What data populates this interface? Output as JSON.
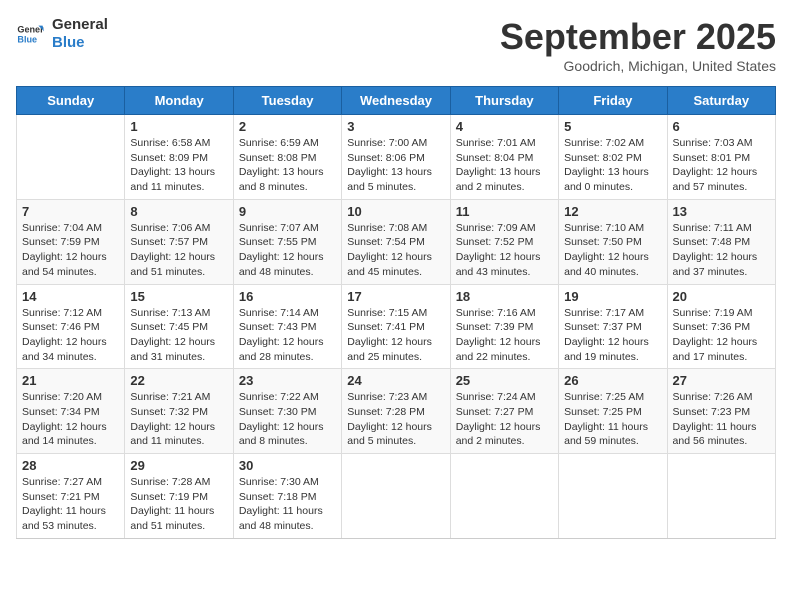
{
  "header": {
    "logo_line1": "General",
    "logo_line2": "Blue",
    "month": "September 2025",
    "location": "Goodrich, Michigan, United States"
  },
  "weekdays": [
    "Sunday",
    "Monday",
    "Tuesday",
    "Wednesday",
    "Thursday",
    "Friday",
    "Saturday"
  ],
  "weeks": [
    [
      {
        "day": "",
        "info": ""
      },
      {
        "day": "1",
        "info": "Sunrise: 6:58 AM\nSunset: 8:09 PM\nDaylight: 13 hours\nand 11 minutes."
      },
      {
        "day": "2",
        "info": "Sunrise: 6:59 AM\nSunset: 8:08 PM\nDaylight: 13 hours\nand 8 minutes."
      },
      {
        "day": "3",
        "info": "Sunrise: 7:00 AM\nSunset: 8:06 PM\nDaylight: 13 hours\nand 5 minutes."
      },
      {
        "day": "4",
        "info": "Sunrise: 7:01 AM\nSunset: 8:04 PM\nDaylight: 13 hours\nand 2 minutes."
      },
      {
        "day": "5",
        "info": "Sunrise: 7:02 AM\nSunset: 8:02 PM\nDaylight: 13 hours\nand 0 minutes."
      },
      {
        "day": "6",
        "info": "Sunrise: 7:03 AM\nSunset: 8:01 PM\nDaylight: 12 hours\nand 57 minutes."
      }
    ],
    [
      {
        "day": "7",
        "info": "Sunrise: 7:04 AM\nSunset: 7:59 PM\nDaylight: 12 hours\nand 54 minutes."
      },
      {
        "day": "8",
        "info": "Sunrise: 7:06 AM\nSunset: 7:57 PM\nDaylight: 12 hours\nand 51 minutes."
      },
      {
        "day": "9",
        "info": "Sunrise: 7:07 AM\nSunset: 7:55 PM\nDaylight: 12 hours\nand 48 minutes."
      },
      {
        "day": "10",
        "info": "Sunrise: 7:08 AM\nSunset: 7:54 PM\nDaylight: 12 hours\nand 45 minutes."
      },
      {
        "day": "11",
        "info": "Sunrise: 7:09 AM\nSunset: 7:52 PM\nDaylight: 12 hours\nand 43 minutes."
      },
      {
        "day": "12",
        "info": "Sunrise: 7:10 AM\nSunset: 7:50 PM\nDaylight: 12 hours\nand 40 minutes."
      },
      {
        "day": "13",
        "info": "Sunrise: 7:11 AM\nSunset: 7:48 PM\nDaylight: 12 hours\nand 37 minutes."
      }
    ],
    [
      {
        "day": "14",
        "info": "Sunrise: 7:12 AM\nSunset: 7:46 PM\nDaylight: 12 hours\nand 34 minutes."
      },
      {
        "day": "15",
        "info": "Sunrise: 7:13 AM\nSunset: 7:45 PM\nDaylight: 12 hours\nand 31 minutes."
      },
      {
        "day": "16",
        "info": "Sunrise: 7:14 AM\nSunset: 7:43 PM\nDaylight: 12 hours\nand 28 minutes."
      },
      {
        "day": "17",
        "info": "Sunrise: 7:15 AM\nSunset: 7:41 PM\nDaylight: 12 hours\nand 25 minutes."
      },
      {
        "day": "18",
        "info": "Sunrise: 7:16 AM\nSunset: 7:39 PM\nDaylight: 12 hours\nand 22 minutes."
      },
      {
        "day": "19",
        "info": "Sunrise: 7:17 AM\nSunset: 7:37 PM\nDaylight: 12 hours\nand 19 minutes."
      },
      {
        "day": "20",
        "info": "Sunrise: 7:19 AM\nSunset: 7:36 PM\nDaylight: 12 hours\nand 17 minutes."
      }
    ],
    [
      {
        "day": "21",
        "info": "Sunrise: 7:20 AM\nSunset: 7:34 PM\nDaylight: 12 hours\nand 14 minutes."
      },
      {
        "day": "22",
        "info": "Sunrise: 7:21 AM\nSunset: 7:32 PM\nDaylight: 12 hours\nand 11 minutes."
      },
      {
        "day": "23",
        "info": "Sunrise: 7:22 AM\nSunset: 7:30 PM\nDaylight: 12 hours\nand 8 minutes."
      },
      {
        "day": "24",
        "info": "Sunrise: 7:23 AM\nSunset: 7:28 PM\nDaylight: 12 hours\nand 5 minutes."
      },
      {
        "day": "25",
        "info": "Sunrise: 7:24 AM\nSunset: 7:27 PM\nDaylight: 12 hours\nand 2 minutes."
      },
      {
        "day": "26",
        "info": "Sunrise: 7:25 AM\nSunset: 7:25 PM\nDaylight: 11 hours\nand 59 minutes."
      },
      {
        "day": "27",
        "info": "Sunrise: 7:26 AM\nSunset: 7:23 PM\nDaylight: 11 hours\nand 56 minutes."
      }
    ],
    [
      {
        "day": "28",
        "info": "Sunrise: 7:27 AM\nSunset: 7:21 PM\nDaylight: 11 hours\nand 53 minutes."
      },
      {
        "day": "29",
        "info": "Sunrise: 7:28 AM\nSunset: 7:19 PM\nDaylight: 11 hours\nand 51 minutes."
      },
      {
        "day": "30",
        "info": "Sunrise: 7:30 AM\nSunset: 7:18 PM\nDaylight: 11 hours\nand 48 minutes."
      },
      {
        "day": "",
        "info": ""
      },
      {
        "day": "",
        "info": ""
      },
      {
        "day": "",
        "info": ""
      },
      {
        "day": "",
        "info": ""
      }
    ]
  ]
}
